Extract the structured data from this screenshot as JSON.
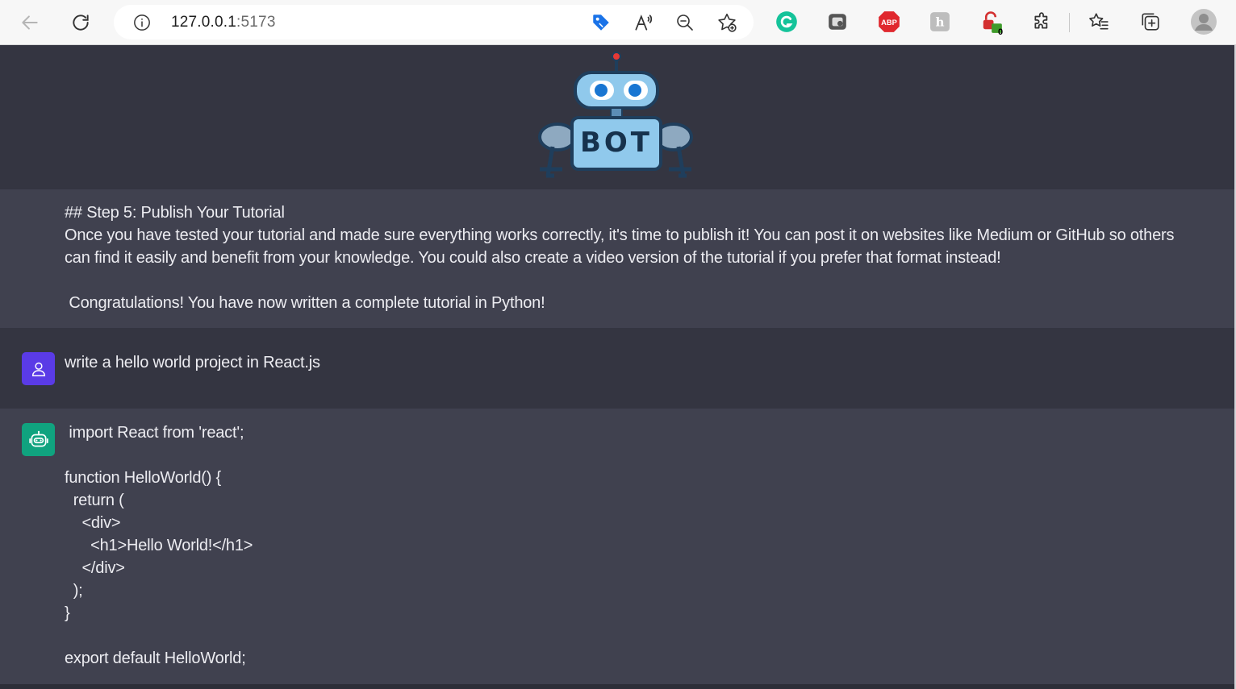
{
  "browser": {
    "url_host": "127.0.0.1",
    "url_port": ":5173",
    "extension_badge_count": "0"
  },
  "header": {
    "logo_text": "BOT"
  },
  "messages": [
    {
      "role": "bot",
      "text": "## Step 5: Publish Your Tutorial\nOnce you have tested your tutorial and made sure everything works correctly, it's time to publish it! You can post it on websites like Medium or GitHub so others can find it easily and benefit from your knowledge. You could also create a video version of the tutorial if you prefer that format instead!\n\n Congratulations! You have now written a complete tutorial in Python!"
    },
    {
      "role": "user",
      "text": "write a hello world project in React.js"
    },
    {
      "role": "bot",
      "text": " import React from 'react';\n\nfunction HelloWorld() {\n  return (\n    <div>\n      <h1>Hello World!</h1>\n    </div>\n  );\n}\n\nexport default HelloWorld;"
    }
  ],
  "colors": {
    "page_bg": "#343541",
    "bot_msg_bg": "#40414f",
    "user_avatar": "#5a3be6",
    "bot_avatar": "#10a37f",
    "text": "#ececf1"
  }
}
